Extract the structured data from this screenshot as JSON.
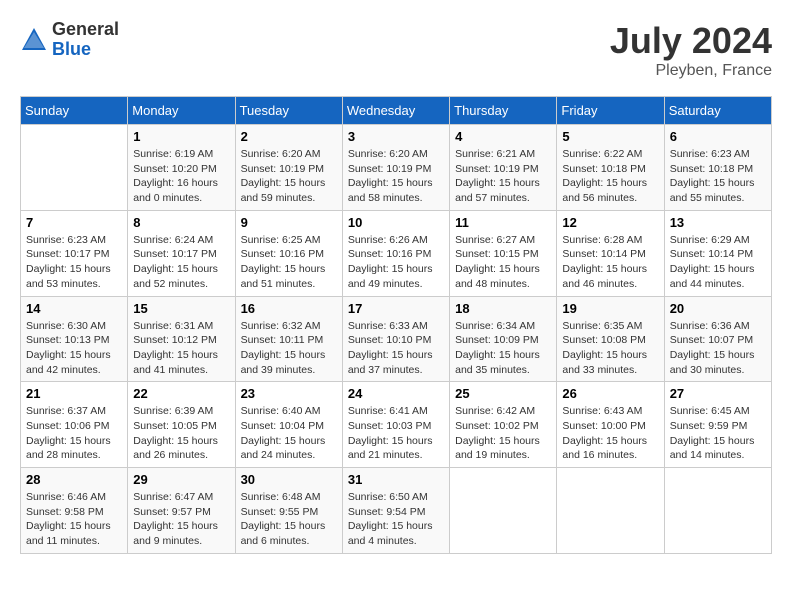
{
  "header": {
    "logo_general": "General",
    "logo_blue": "Blue",
    "month_year": "July 2024",
    "location": "Pleyben, France"
  },
  "columns": [
    "Sunday",
    "Monday",
    "Tuesday",
    "Wednesday",
    "Thursday",
    "Friday",
    "Saturday"
  ],
  "weeks": [
    [
      {
        "day": "",
        "sunrise": "",
        "sunset": "",
        "daylight": ""
      },
      {
        "day": "1",
        "sunrise": "Sunrise: 6:19 AM",
        "sunset": "Sunset: 10:20 PM",
        "daylight": "Daylight: 16 hours and 0 minutes."
      },
      {
        "day": "2",
        "sunrise": "Sunrise: 6:20 AM",
        "sunset": "Sunset: 10:19 PM",
        "daylight": "Daylight: 15 hours and 59 minutes."
      },
      {
        "day": "3",
        "sunrise": "Sunrise: 6:20 AM",
        "sunset": "Sunset: 10:19 PM",
        "daylight": "Daylight: 15 hours and 58 minutes."
      },
      {
        "day": "4",
        "sunrise": "Sunrise: 6:21 AM",
        "sunset": "Sunset: 10:19 PM",
        "daylight": "Daylight: 15 hours and 57 minutes."
      },
      {
        "day": "5",
        "sunrise": "Sunrise: 6:22 AM",
        "sunset": "Sunset: 10:18 PM",
        "daylight": "Daylight: 15 hours and 56 minutes."
      },
      {
        "day": "6",
        "sunrise": "Sunrise: 6:23 AM",
        "sunset": "Sunset: 10:18 PM",
        "daylight": "Daylight: 15 hours and 55 minutes."
      }
    ],
    [
      {
        "day": "7",
        "sunrise": "Sunrise: 6:23 AM",
        "sunset": "Sunset: 10:17 PM",
        "daylight": "Daylight: 15 hours and 53 minutes."
      },
      {
        "day": "8",
        "sunrise": "Sunrise: 6:24 AM",
        "sunset": "Sunset: 10:17 PM",
        "daylight": "Daylight: 15 hours and 52 minutes."
      },
      {
        "day": "9",
        "sunrise": "Sunrise: 6:25 AM",
        "sunset": "Sunset: 10:16 PM",
        "daylight": "Daylight: 15 hours and 51 minutes."
      },
      {
        "day": "10",
        "sunrise": "Sunrise: 6:26 AM",
        "sunset": "Sunset: 10:16 PM",
        "daylight": "Daylight: 15 hours and 49 minutes."
      },
      {
        "day": "11",
        "sunrise": "Sunrise: 6:27 AM",
        "sunset": "Sunset: 10:15 PM",
        "daylight": "Daylight: 15 hours and 48 minutes."
      },
      {
        "day": "12",
        "sunrise": "Sunrise: 6:28 AM",
        "sunset": "Sunset: 10:14 PM",
        "daylight": "Daylight: 15 hours and 46 minutes."
      },
      {
        "day": "13",
        "sunrise": "Sunrise: 6:29 AM",
        "sunset": "Sunset: 10:14 PM",
        "daylight": "Daylight: 15 hours and 44 minutes."
      }
    ],
    [
      {
        "day": "14",
        "sunrise": "Sunrise: 6:30 AM",
        "sunset": "Sunset: 10:13 PM",
        "daylight": "Daylight: 15 hours and 42 minutes."
      },
      {
        "day": "15",
        "sunrise": "Sunrise: 6:31 AM",
        "sunset": "Sunset: 10:12 PM",
        "daylight": "Daylight: 15 hours and 41 minutes."
      },
      {
        "day": "16",
        "sunrise": "Sunrise: 6:32 AM",
        "sunset": "Sunset: 10:11 PM",
        "daylight": "Daylight: 15 hours and 39 minutes."
      },
      {
        "day": "17",
        "sunrise": "Sunrise: 6:33 AM",
        "sunset": "Sunset: 10:10 PM",
        "daylight": "Daylight: 15 hours and 37 minutes."
      },
      {
        "day": "18",
        "sunrise": "Sunrise: 6:34 AM",
        "sunset": "Sunset: 10:09 PM",
        "daylight": "Daylight: 15 hours and 35 minutes."
      },
      {
        "day": "19",
        "sunrise": "Sunrise: 6:35 AM",
        "sunset": "Sunset: 10:08 PM",
        "daylight": "Daylight: 15 hours and 33 minutes."
      },
      {
        "day": "20",
        "sunrise": "Sunrise: 6:36 AM",
        "sunset": "Sunset: 10:07 PM",
        "daylight": "Daylight: 15 hours and 30 minutes."
      }
    ],
    [
      {
        "day": "21",
        "sunrise": "Sunrise: 6:37 AM",
        "sunset": "Sunset: 10:06 PM",
        "daylight": "Daylight: 15 hours and 28 minutes."
      },
      {
        "day": "22",
        "sunrise": "Sunrise: 6:39 AM",
        "sunset": "Sunset: 10:05 PM",
        "daylight": "Daylight: 15 hours and 26 minutes."
      },
      {
        "day": "23",
        "sunrise": "Sunrise: 6:40 AM",
        "sunset": "Sunset: 10:04 PM",
        "daylight": "Daylight: 15 hours and 24 minutes."
      },
      {
        "day": "24",
        "sunrise": "Sunrise: 6:41 AM",
        "sunset": "Sunset: 10:03 PM",
        "daylight": "Daylight: 15 hours and 21 minutes."
      },
      {
        "day": "25",
        "sunrise": "Sunrise: 6:42 AM",
        "sunset": "Sunset: 10:02 PM",
        "daylight": "Daylight: 15 hours and 19 minutes."
      },
      {
        "day": "26",
        "sunrise": "Sunrise: 6:43 AM",
        "sunset": "Sunset: 10:00 PM",
        "daylight": "Daylight: 15 hours and 16 minutes."
      },
      {
        "day": "27",
        "sunrise": "Sunrise: 6:45 AM",
        "sunset": "Sunset: 9:59 PM",
        "daylight": "Daylight: 15 hours and 14 minutes."
      }
    ],
    [
      {
        "day": "28",
        "sunrise": "Sunrise: 6:46 AM",
        "sunset": "Sunset: 9:58 PM",
        "daylight": "Daylight: 15 hours and 11 minutes."
      },
      {
        "day": "29",
        "sunrise": "Sunrise: 6:47 AM",
        "sunset": "Sunset: 9:57 PM",
        "daylight": "Daylight: 15 hours and 9 minutes."
      },
      {
        "day": "30",
        "sunrise": "Sunrise: 6:48 AM",
        "sunset": "Sunset: 9:55 PM",
        "daylight": "Daylight: 15 hours and 6 minutes."
      },
      {
        "day": "31",
        "sunrise": "Sunrise: 6:50 AM",
        "sunset": "Sunset: 9:54 PM",
        "daylight": "Daylight: 15 hours and 4 minutes."
      },
      {
        "day": "",
        "sunrise": "",
        "sunset": "",
        "daylight": ""
      },
      {
        "day": "",
        "sunrise": "",
        "sunset": "",
        "daylight": ""
      },
      {
        "day": "",
        "sunrise": "",
        "sunset": "",
        "daylight": ""
      }
    ]
  ]
}
